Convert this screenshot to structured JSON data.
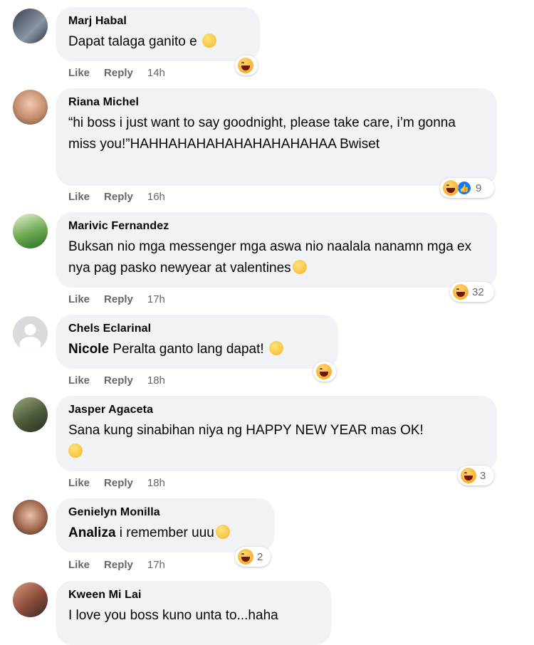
{
  "actions": {
    "like": "Like",
    "reply": "Reply"
  },
  "comments": [
    {
      "author": "Marj Habal",
      "text": "Dapat talaga ganito e",
      "time": "14h",
      "reaction_count": ""
    },
    {
      "author": "Riana Michel",
      "text": "“hi boss i just want to say goodnight, please take care, i’m gonna miss you!”HAHHAHAHAHAHAHAHAHAHAA Bwiset",
      "time": "16h",
      "reaction_count": "9"
    },
    {
      "author": "Marivic Fernandez",
      "text": "Buksan nio mga messenger mga aswa nio naalala nanamn mga ex nya pag pasko newyear at valentines",
      "time": "17h",
      "reaction_count": "32"
    },
    {
      "author": "Chels Eclarinal",
      "mention": "Nicole",
      "text": " Peralta ganto lang dapat!",
      "time": "18h",
      "reaction_count": ""
    },
    {
      "author": "Jasper Agaceta",
      "text": "Sana kung sinabihan niya ng HAPPY NEW YEAR mas OK!",
      "time": "18h",
      "reaction_count": "3"
    },
    {
      "author": "Genielyn Monilla",
      "mention": "Analiza",
      "text": " i remember uuu",
      "time": "17h",
      "reaction_count": "2"
    },
    {
      "author": "Kween Mi Lai",
      "text": "I love you boss kuno unta to...haha",
      "time": "",
      "reaction_count": ""
    }
  ]
}
